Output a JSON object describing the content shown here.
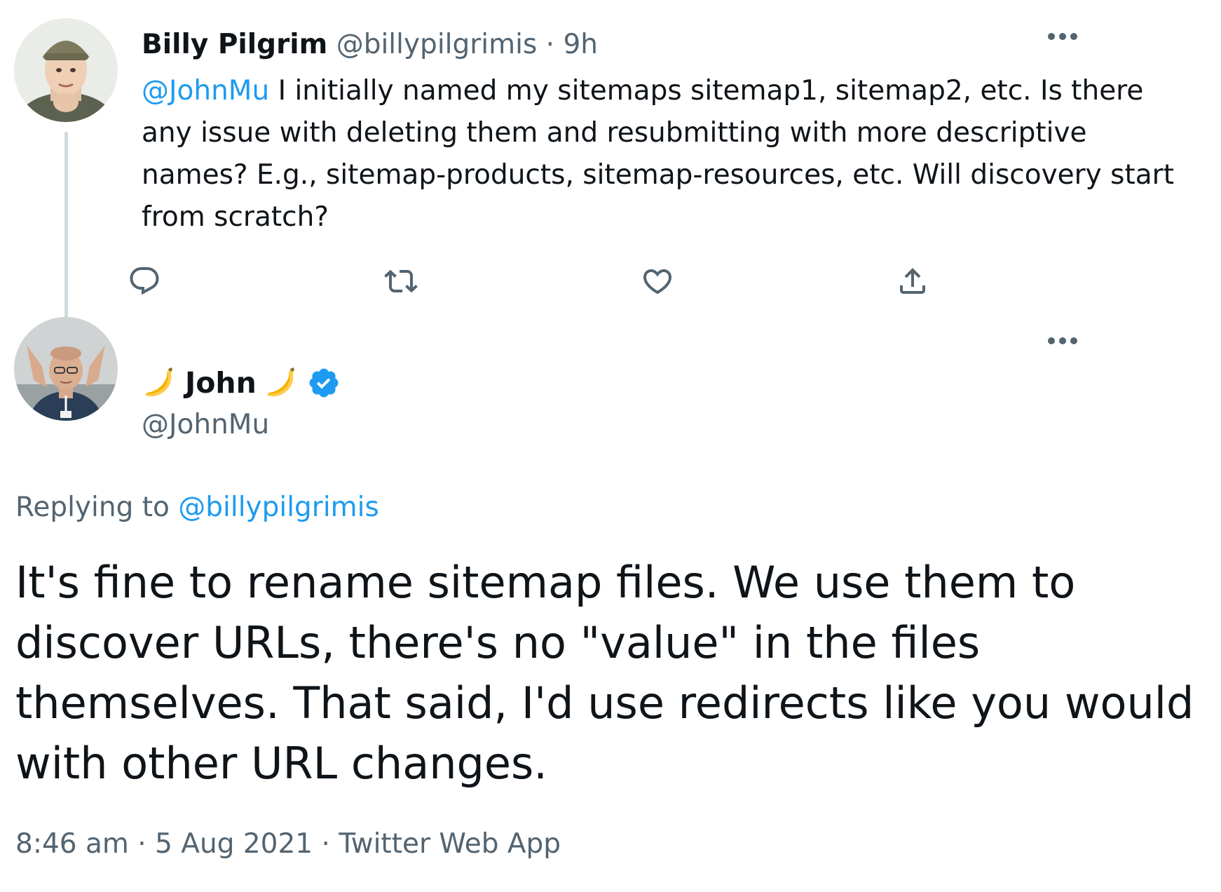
{
  "parent_tweet": {
    "author_name": "Billy Pilgrim",
    "author_handle": "@billypilgrimis",
    "separator": "·",
    "time_ago": "9h",
    "mention": "@JohnMu",
    "text": " I initially named my sitemaps sitemap1, sitemap2, etc. Is there any issue with deleting them and resubmitting with more descriptive names? E.g., sitemap-products, sitemap-resources, etc. Will discovery start from scratch?",
    "actions": [
      "reply-icon",
      "retweet-icon",
      "like-icon",
      "share-icon"
    ]
  },
  "main_tweet": {
    "author_name": "John",
    "author_handle": "@JohnMu",
    "verified": true,
    "replying_label": "Replying to",
    "replying_to": "@billypilgrimis",
    "text": "It's fine to rename sitemap files. We use them to discover URLs, there's no \"value\" in the files themselves. That said, I'd use redirects like you would with other URL changes.",
    "time": "8:46 am",
    "date": "5 Aug 2021",
    "source": "Twitter Web App",
    "separator": "·"
  },
  "colors": {
    "link": "#1d9bf0",
    "muted": "#536471",
    "text": "#0f1419",
    "thread_line": "#cfd9de",
    "verified": "#1d9bf0"
  }
}
